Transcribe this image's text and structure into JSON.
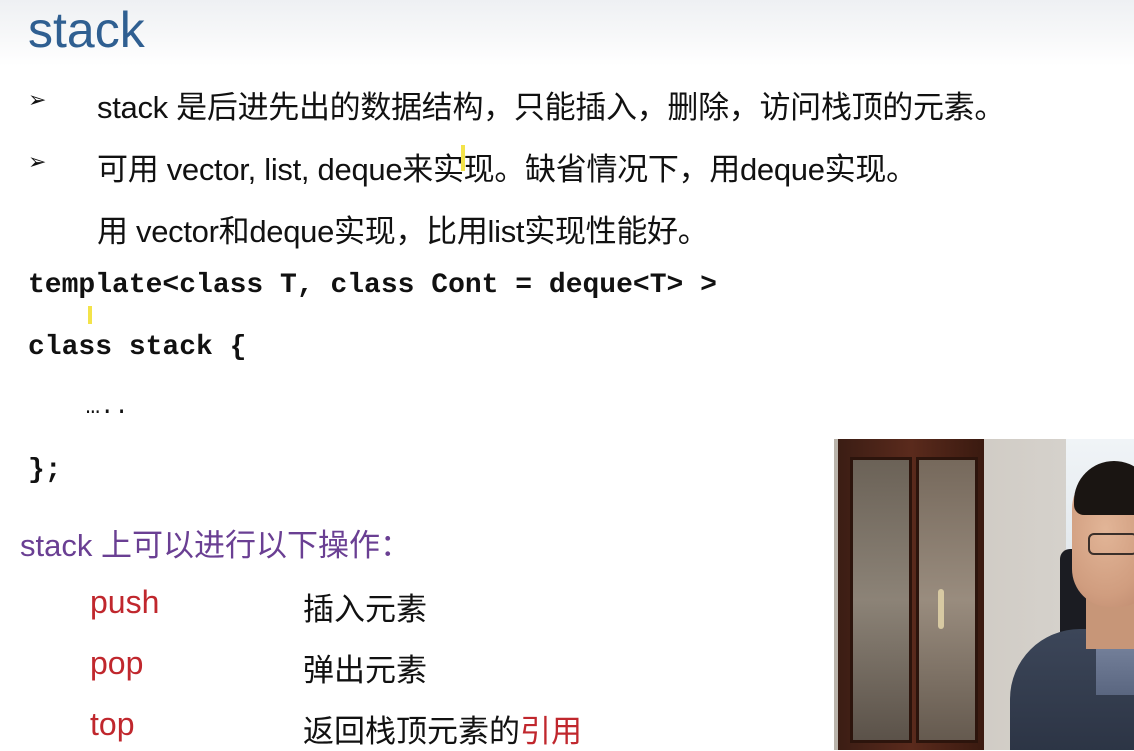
{
  "title": "stack",
  "bullets": [
    {
      "marker": "➢",
      "text": "stack 是后进先出的数据结构，只能插入，删除，访问栈顶的元素。"
    },
    {
      "marker": "➢",
      "text": "可用 vector,  list, deque来实现。缺省情况下，用deque实现。",
      "continuation": "用 vector和deque实现，比用list实现性能好。"
    }
  ],
  "code": {
    "line1": "template<class T, class Cont = deque<T> >",
    "line2": "class stack {",
    "line3": "    ….. ",
    "line4": "};"
  },
  "operations": {
    "heading": "stack 上可以进行以下操作：",
    "items": [
      {
        "name": "push",
        "desc": "插入元素",
        "desc_highlight": ""
      },
      {
        "name": "pop",
        "desc": "弹出元素",
        "desc_highlight": ""
      },
      {
        "name": "top",
        "desc": "返回栈顶元素的",
        "desc_highlight": "引用"
      }
    ]
  },
  "colors": {
    "title": "#2f5f91",
    "heading": "#6a3f93",
    "op_name": "#c0272d",
    "highlight": "#c0272d"
  }
}
